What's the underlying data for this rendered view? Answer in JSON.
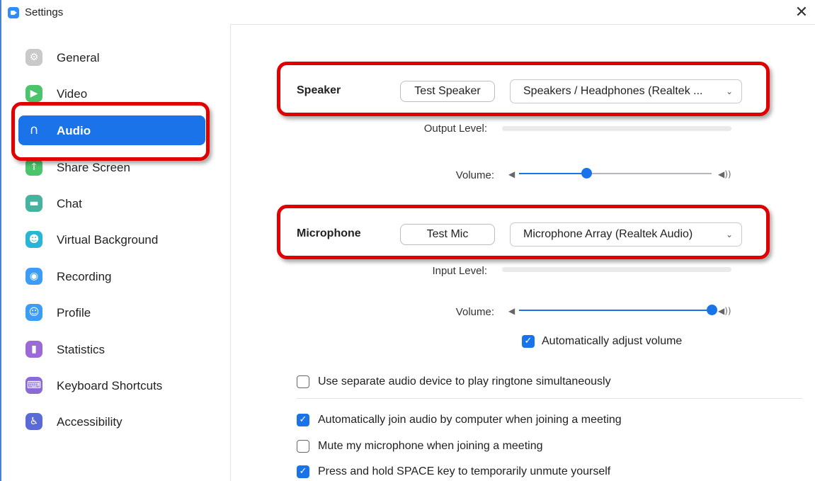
{
  "window": {
    "title": "Settings",
    "close_glyph": "✕"
  },
  "sidebar": {
    "items": [
      {
        "label": "General",
        "icon": "gear-icon",
        "color": "#c9c9c9",
        "glyph": "⚙",
        "active": false
      },
      {
        "label": "Video",
        "icon": "video-camera-icon",
        "color": "#4cc46b",
        "glyph": "▶",
        "active": false
      },
      {
        "label": "Audio",
        "icon": "headphones-icon",
        "color": "#1a73e8",
        "glyph": "∩",
        "active": true
      },
      {
        "label": "Share Screen",
        "icon": "share-screen-icon",
        "color": "#4cc46b",
        "glyph": "↑",
        "active": false
      },
      {
        "label": "Chat",
        "icon": "chat-bubble-icon",
        "color": "#45b39d",
        "glyph": "▬",
        "active": false
      },
      {
        "label": "Virtual Background",
        "icon": "person-background-icon",
        "color": "#29b6d4",
        "glyph": "☻",
        "active": false
      },
      {
        "label": "Recording",
        "icon": "record-icon",
        "color": "#3d9df6",
        "glyph": "◉",
        "active": false
      },
      {
        "label": "Profile",
        "icon": "profile-person-icon",
        "color": "#3d9df6",
        "glyph": "☺",
        "active": false
      },
      {
        "label": "Statistics",
        "icon": "bar-chart-icon",
        "color": "#9b6ad6",
        "glyph": "▮",
        "active": false
      },
      {
        "label": "Keyboard Shortcuts",
        "icon": "keyboard-icon",
        "color": "#8a6ad6",
        "glyph": "⌨",
        "active": false
      },
      {
        "label": "Accessibility",
        "icon": "accessibility-person-icon",
        "color": "#5a6ad6",
        "glyph": "♿",
        "active": false
      }
    ]
  },
  "speaker": {
    "label": "Speaker",
    "test_button": "Test Speaker",
    "device": "Speakers / Headphones (Realtek ...",
    "output_level_label": "Output Level:",
    "volume_label": "Volume:",
    "volume_fraction": 0.35
  },
  "microphone": {
    "label": "Microphone",
    "test_button": "Test Mic",
    "device": "Microphone Array (Realtek Audio)",
    "input_level_label": "Input Level:",
    "volume_label": "Volume:",
    "volume_fraction": 1.0,
    "auto_adjust_label": "Automatically adjust volume",
    "auto_adjust_checked": true
  },
  "options": [
    {
      "label": "Use separate audio device to play ringtone simultaneously",
      "checked": false
    },
    {
      "label": "Automatically join audio by computer when joining a meeting",
      "checked": true
    },
    {
      "label": "Mute my microphone when joining a meeting",
      "checked": false
    },
    {
      "label": "Press and hold SPACE key to temporarily unmute yourself",
      "checked": true
    }
  ],
  "chevron_glyph": "⌄",
  "check_glyph": "✓",
  "vol_low_glyph": "◀",
  "vol_high_glyph": "◀))",
  "colors": {
    "accent": "#1a73e8",
    "highlight": "#e00000"
  }
}
